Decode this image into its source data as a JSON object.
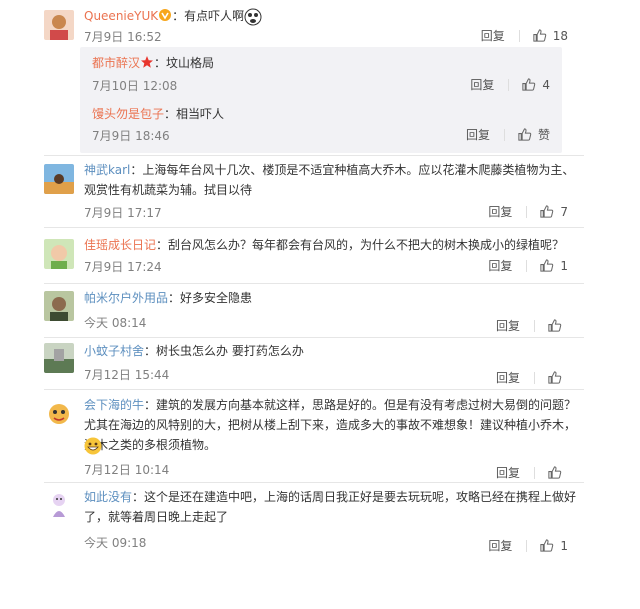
{
  "colors": {
    "username": "#eb7350",
    "meta": "#808080",
    "text": "#333333",
    "reply_bg": "#f2f2f5"
  },
  "comments": [
    {
      "username": "QueenieYUK",
      "text": "：有点吓人啊",
      "time": "7月9日 16:52",
      "reply": "回复",
      "likes": "18",
      "replies": [
        {
          "username": "都市醉汉",
          "text": "：坟山格局",
          "time": "7月10日 12:08",
          "reply": "回复",
          "likes": "4"
        },
        {
          "username": "馒头勿是包子",
          "text": "：相当吓人",
          "time": "7月9日 18:46",
          "reply": "回复",
          "likes": "赞"
        }
      ]
    },
    {
      "username": "神武karl",
      "text": "：上海每年台风十几次、楼顶是不适宜种植高大乔木。应以花灌木爬藤类植物为主、观赏性有机蔬菜为辅。拭目以待",
      "time": "7月9日 17:17",
      "reply": "回复",
      "likes": "7"
    },
    {
      "username": "佳瑶成长日记",
      "text": "：刮台风怎么办？每年都会有台风的，为什么不把大的树木换成小的绿植呢？",
      "time": "7月9日 17:24",
      "reply": "回复",
      "likes": "1"
    },
    {
      "username": "帕米尔户外用品",
      "text": "：好多安全隐患",
      "time": "今天 08:14",
      "reply": "回复",
      "likes": ""
    },
    {
      "username": "小蚊子村舍",
      "text": "：树长虫怎么办 要打药怎么办",
      "time": "7月12日 15:44",
      "reply": "回复",
      "likes": ""
    },
    {
      "username": "会下海的牛",
      "text": "：建筑的发展方向基本就这样，思路是好的。但是有没有考虑过树大易倒的问题？尤其在海边的风特别的大，把树从楼上刮下来，造成多大的事故不难想象！建议种植小乔木，灌木之类的多根须植物。",
      "time": "7月12日 10:14",
      "reply": "回复",
      "likes": ""
    },
    {
      "username": "如此没有",
      "text": "：这个是还在建造中吧，上海的话周日我正好是要去玩玩呢，攻略已经在携程上做好了，就等着周日晚上走起了",
      "time": "今天 09:18",
      "reply": "回复",
      "likes": "1"
    }
  ]
}
